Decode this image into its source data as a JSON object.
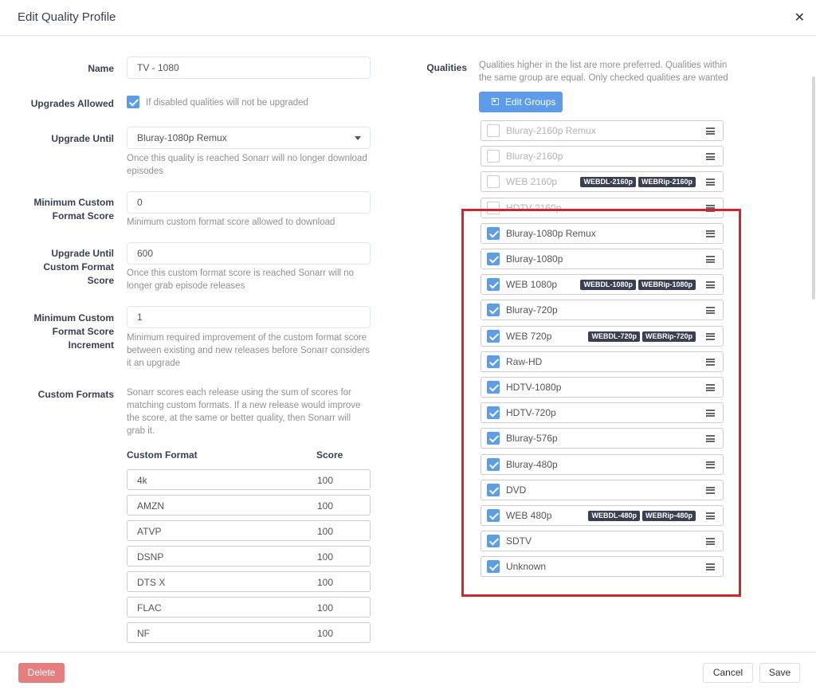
{
  "header": {
    "title": "Edit Quality Profile",
    "close_icon": "close-icon"
  },
  "form": {
    "name_label": "Name",
    "name_value": "TV - 1080",
    "upgrades_label": "Upgrades Allowed",
    "upgrades_checked": true,
    "upgrades_help": "If disabled qualities will not be upgraded",
    "upgrade_until_label": "Upgrade Until",
    "upgrade_until_value": "Bluray-1080p Remux",
    "upgrade_until_help": "Once this quality is reached Sonarr will no longer download episodes",
    "min_cf_label": "Minimum Custom Format Score",
    "min_cf_value": "0",
    "min_cf_help": "Minimum custom format score allowed to download",
    "upgrade_cf_label": "Upgrade Until Custom Format Score",
    "upgrade_cf_value": "600",
    "upgrade_cf_help": "Once this custom format score is reached Sonarr will no longer grab episode releases",
    "min_cf_inc_label": "Minimum Custom Format Score Increment",
    "min_cf_inc_value": "1",
    "min_cf_inc_help": "Minimum required improvement of the custom format score between existing and new releases before Sonarr considers it an upgrade",
    "custom_formats_label": "Custom Formats",
    "custom_formats_help": "Sonarr scores each release using the sum of scores for matching custom formats. If a new release would improve the score, at the same or better quality, then Sonarr will grab it.",
    "cf_col_format": "Custom Format",
    "cf_col_score": "Score",
    "custom_formats": [
      {
        "name": "4k",
        "score": "100"
      },
      {
        "name": "AMZN",
        "score": "100"
      },
      {
        "name": "ATVP",
        "score": "100"
      },
      {
        "name": "DSNP",
        "score": "100"
      },
      {
        "name": "DTS X",
        "score": "100"
      },
      {
        "name": "FLAC",
        "score": "100"
      },
      {
        "name": "NF",
        "score": "100"
      }
    ]
  },
  "qualities": {
    "label": "Qualities",
    "help": "Qualities higher in the list are more preferred. Qualities within the same group are equal. Only checked qualities are wanted",
    "edit_groups_label": "Edit Groups",
    "items": [
      {
        "name": "Bluray-2160p Remux",
        "checked": false,
        "tags": []
      },
      {
        "name": "Bluray-2160p",
        "checked": false,
        "tags": []
      },
      {
        "name": "WEB 2160p",
        "checked": false,
        "tags": [
          "WEBDL-2160p",
          "WEBRip-2160p"
        ]
      },
      {
        "name": "HDTV-2160p",
        "checked": false,
        "tags": []
      },
      {
        "name": "Bluray-1080p Remux",
        "checked": true,
        "tags": []
      },
      {
        "name": "Bluray-1080p",
        "checked": true,
        "tags": []
      },
      {
        "name": "WEB 1080p",
        "checked": true,
        "tags": [
          "WEBDL-1080p",
          "WEBRip-1080p"
        ]
      },
      {
        "name": "Bluray-720p",
        "checked": true,
        "tags": []
      },
      {
        "name": "WEB 720p",
        "checked": true,
        "tags": [
          "WEBDL-720p",
          "WEBRip-720p"
        ]
      },
      {
        "name": "Raw-HD",
        "checked": true,
        "tags": []
      },
      {
        "name": "HDTV-1080p",
        "checked": true,
        "tags": []
      },
      {
        "name": "HDTV-720p",
        "checked": true,
        "tags": []
      },
      {
        "name": "Bluray-576p",
        "checked": true,
        "tags": []
      },
      {
        "name": "Bluray-480p",
        "checked": true,
        "tags": []
      },
      {
        "name": "DVD",
        "checked": true,
        "tags": []
      },
      {
        "name": "WEB 480p",
        "checked": true,
        "tags": [
          "WEBDL-480p",
          "WEBRip-480p"
        ]
      },
      {
        "name": "SDTV",
        "checked": true,
        "tags": []
      },
      {
        "name": "Unknown",
        "checked": true,
        "tags": []
      }
    ]
  },
  "footer": {
    "delete_label": "Delete",
    "cancel_label": "Cancel",
    "save_label": "Save"
  },
  "colors": {
    "accent": "#5d9cec",
    "danger": "#e57f7f",
    "highlight": "#d0252c",
    "tag": "#3a3f51"
  }
}
